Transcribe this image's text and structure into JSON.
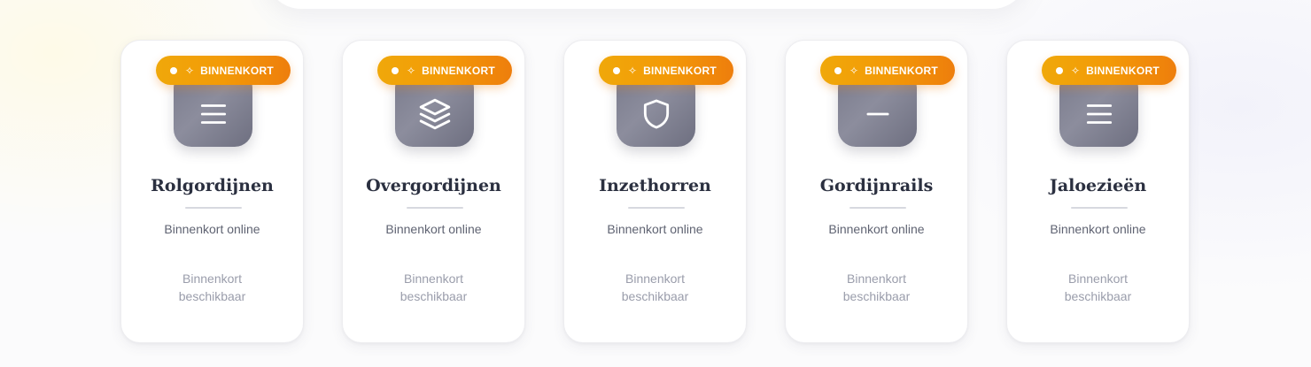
{
  "badge": {
    "label": "BINNENKORT",
    "icon": "sparkle-icon"
  },
  "colors": {
    "badge_start": "#f0a80a",
    "badge_end": "#ee7e0c",
    "icon_tile": "#7a7b8c",
    "title": "#2b3040"
  },
  "cards": [
    {
      "title": "Rolgordijnen",
      "subtitle": "Binnenkort online",
      "availability": "Binnenkort beschikbaar",
      "icon": "menu-icon"
    },
    {
      "title": "Overgordijnen",
      "subtitle": "Binnenkort online",
      "availability": "Binnenkort beschikbaar",
      "icon": "layers-icon"
    },
    {
      "title": "Inzethorren",
      "subtitle": "Binnenkort online",
      "availability": "Binnenkort beschikbaar",
      "icon": "shield-icon"
    },
    {
      "title": "Gordijnrails",
      "subtitle": "Binnenkort online",
      "availability": "Binnenkort beschikbaar",
      "icon": "minus-icon"
    },
    {
      "title": "Jaloezieën",
      "subtitle": "Binnenkort online",
      "availability": "Binnenkort beschikbaar",
      "icon": "menu-icon"
    }
  ]
}
